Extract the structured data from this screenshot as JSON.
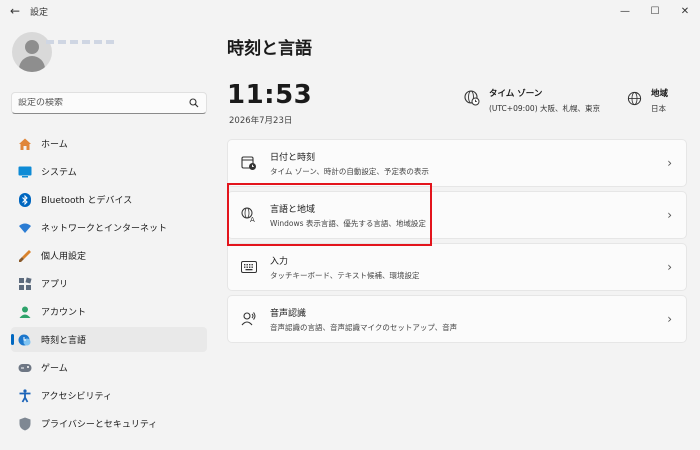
{
  "window": {
    "title": "設定",
    "back_icon": "←",
    "minimize_icon": "—",
    "maximize_icon": "☐",
    "close_icon": "✕"
  },
  "search": {
    "placeholder": "設定の検索"
  },
  "sidebar": {
    "items": [
      {
        "label": "ホーム",
        "icon": "home-icon",
        "active": false
      },
      {
        "label": "システム",
        "icon": "system-icon",
        "active": false
      },
      {
        "label": "Bluetooth とデバイス",
        "icon": "bluetooth-icon",
        "active": false
      },
      {
        "label": "ネットワークとインターネット",
        "icon": "wifi-icon",
        "active": false
      },
      {
        "label": "個人用設定",
        "icon": "brush-icon",
        "active": false
      },
      {
        "label": "アプリ",
        "icon": "apps-icon",
        "active": false
      },
      {
        "label": "アカウント",
        "icon": "account-icon",
        "active": false
      },
      {
        "label": "時刻と言語",
        "icon": "time-language-icon",
        "active": true
      },
      {
        "label": "ゲーム",
        "icon": "gamepad-icon",
        "active": false
      },
      {
        "label": "アクセシビリティ",
        "icon": "accessibility-icon",
        "active": false
      },
      {
        "label": "プライバシーとセキュリティ",
        "icon": "shield-icon",
        "active": false
      }
    ]
  },
  "main": {
    "title": "時刻と言語",
    "time": "11:53",
    "date": "2026年7月23日",
    "timezone": {
      "label": "タイム ゾーン",
      "value": "(UTC+09:00) 大阪、札幌、東京"
    },
    "region": {
      "label": "地域",
      "value": "日本"
    },
    "cards": [
      {
        "title": "日付と時刻",
        "desc": "タイム ゾーン、時計の自動設定、予定表の表示",
        "icon": "calendar-clock-icon"
      },
      {
        "title": "言語と地域",
        "desc": "Windows 表示言語、優先する言語、地域設定",
        "icon": "language-icon"
      },
      {
        "title": "入力",
        "desc": "タッチキーボード、テキスト候補、環境設定",
        "icon": "keyboard-icon"
      },
      {
        "title": "音声認識",
        "desc": "音声認識の言語、音声認識マイクのセットアップ、音声",
        "icon": "speech-icon"
      }
    ],
    "chevron": "›"
  },
  "colors": {
    "accent": "#0067c0",
    "highlight": "#e3141c"
  }
}
